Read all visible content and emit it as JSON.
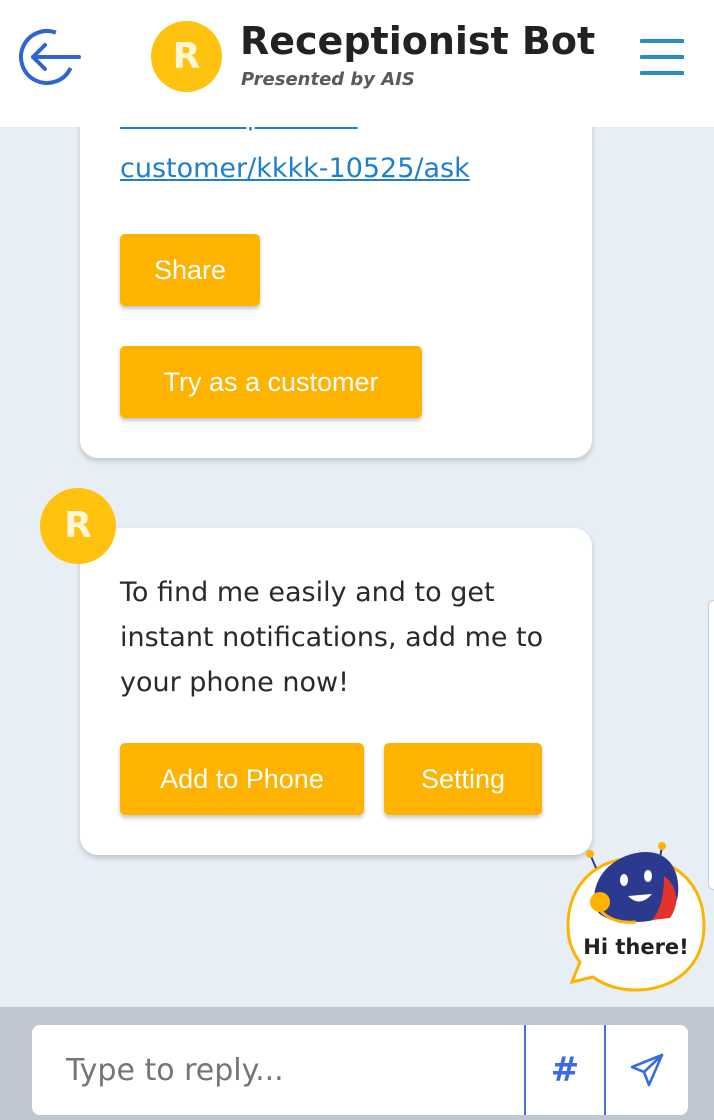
{
  "header": {
    "title": "Receptionist Bot",
    "subtitle": "Presented by AIS",
    "logo_letter": "R"
  },
  "messages": [
    {
      "link_partial": "chat/receptionist-",
      "link_text": "customer/kkkk-10525/ask",
      "buttons": [
        "Share",
        "Try as a customer"
      ]
    },
    {
      "avatar_letter": "R",
      "text": "To find me easily and to get instant notifications, add me to your phone now!",
      "buttons": [
        "Add to Phone",
        "Setting"
      ]
    }
  ],
  "helper": {
    "greeting": "Hi there!"
  },
  "composer": {
    "placeholder": "Type to reply...",
    "hash_label": "#"
  },
  "colors": {
    "accent": "#fdb300",
    "logo": "#ffc20e",
    "link": "#1f7fcf",
    "menu": "#2b8ac8",
    "send": "#3a6be0"
  },
  "icons": {
    "back": "back-arrow-icon",
    "menu": "hamburger-menu-icon",
    "send": "paper-plane-icon",
    "helper": "robot-mascot-icon"
  }
}
